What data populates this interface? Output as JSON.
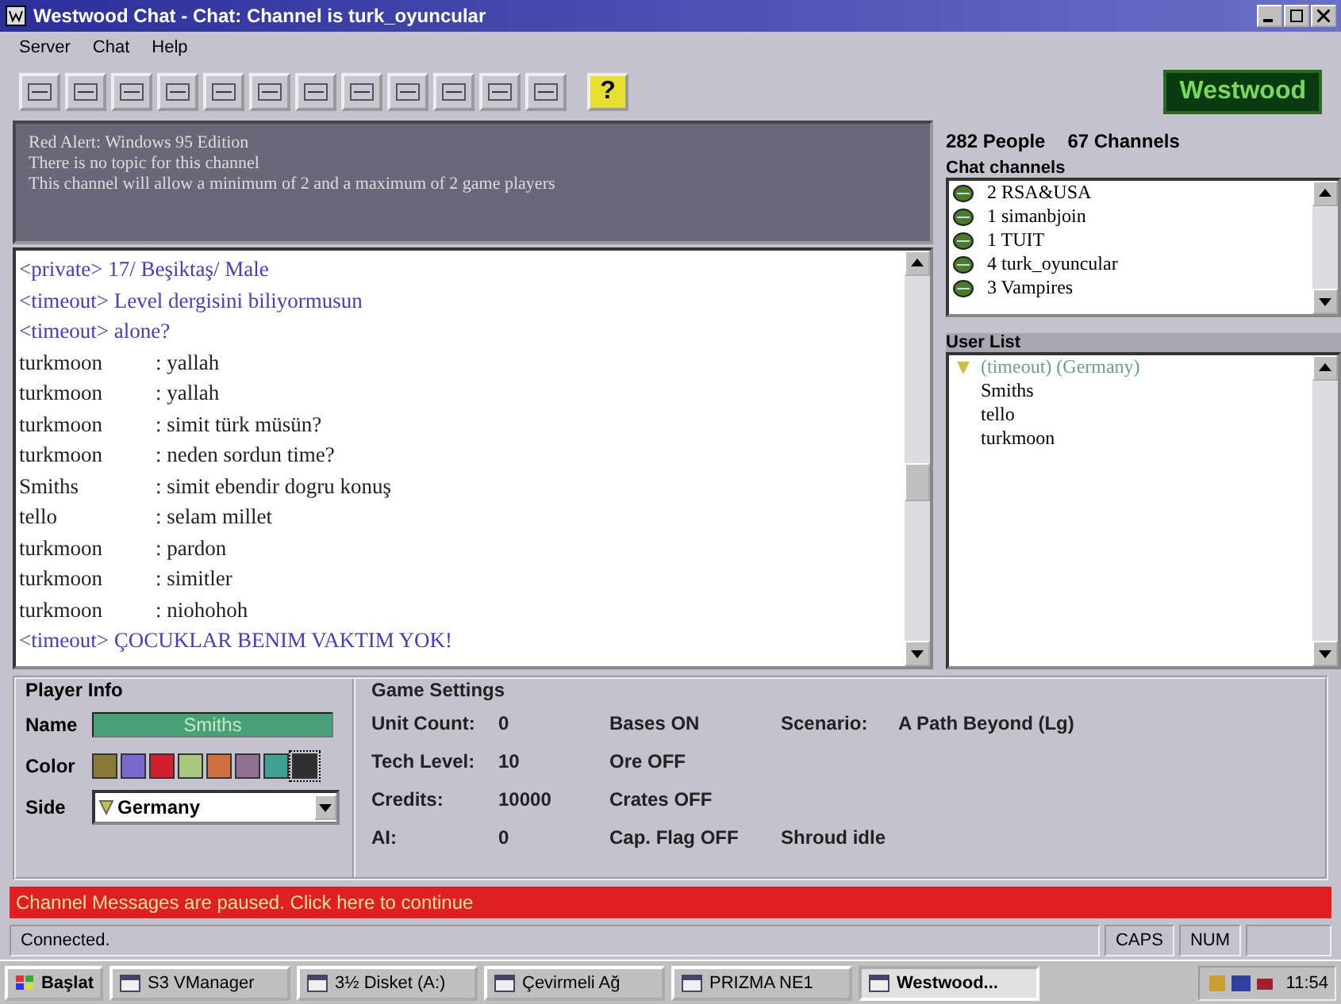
{
  "window": {
    "title": "Westwood Chat - Chat: Channel is turk_oyuncular"
  },
  "menu": [
    "Server",
    "Chat",
    "Help"
  ],
  "toolbar": {
    "help_label": "?",
    "logo": "Westwood"
  },
  "topic": [
    "Red Alert: Windows 95 Edition",
    "There is no topic for this channel",
    "This channel will allow a minimum of 2 and a maximum of 2 game players"
  ],
  "counts": {
    "people": "282",
    "people_label": "People",
    "channels": "67",
    "channels_label": "Channels"
  },
  "chat": [
    {
      "kind": "system",
      "text": "<private> 17/ Beşiktaş/ Male"
    },
    {
      "kind": "system",
      "text": "<timeout> Level dergisini biliyormusun"
    },
    {
      "kind": "system",
      "text": "<timeout> alone?"
    },
    {
      "kind": "user",
      "nick": "turkmoon",
      "text": ": yallah"
    },
    {
      "kind": "user",
      "nick": "turkmoon",
      "text": ": yallah"
    },
    {
      "kind": "user",
      "nick": "turkmoon",
      "text": ": simit türk müsün?"
    },
    {
      "kind": "user",
      "nick": "turkmoon",
      "text": ": neden sordun time?"
    },
    {
      "kind": "user",
      "nick": "Smiths",
      "text": ": simit ebendir dogru konuş"
    },
    {
      "kind": "user",
      "nick": "tello",
      "text": ": selam millet"
    },
    {
      "kind": "user",
      "nick": "turkmoon",
      "text": ": pardon"
    },
    {
      "kind": "user",
      "nick": "turkmoon",
      "text": ": simitler"
    },
    {
      "kind": "user",
      "nick": "turkmoon",
      "text": ": niohohoh"
    },
    {
      "kind": "system",
      "text": "<timeout> ÇOCUKLAR BENIM VAKTIM YOK!"
    }
  ],
  "chat_channels": {
    "title": "Chat channels",
    "items": [
      {
        "count": "2",
        "name": "RSA&USA",
        "selected": false
      },
      {
        "count": "1",
        "name": "simanbjoin",
        "selected": false
      },
      {
        "count": "1",
        "name": "TUIT",
        "selected": false
      },
      {
        "count": "4",
        "name": "turk_oyuncular",
        "selected": false
      },
      {
        "count": "3",
        "name": "Vampires",
        "selected": false
      }
    ]
  },
  "user_list": {
    "title": "User List",
    "items": [
      {
        "kind": "host",
        "name": "(timeout) (Germany)"
      },
      {
        "kind": "user",
        "name": "Smiths"
      },
      {
        "kind": "user",
        "name": "tello"
      },
      {
        "kind": "user",
        "name": "turkmoon"
      }
    ]
  },
  "player_info": {
    "title": "Player Info",
    "name_label": "Name",
    "name": "Smiths",
    "color_label": "Color",
    "colors": [
      {
        "color": "#8a7a3a",
        "selected": false
      },
      {
        "color": "#7a6ad0",
        "selected": false
      },
      {
        "color": "#d02030",
        "selected": false
      },
      {
        "color": "#a8c880",
        "selected": false
      },
      {
        "color": "#d07040",
        "selected": false
      },
      {
        "color": "#907090",
        "selected": false
      },
      {
        "color": "#40a090",
        "selected": false
      },
      {
        "color": "#303030",
        "selected": true
      }
    ],
    "side_label": "Side",
    "side": "Germany"
  },
  "game_settings": {
    "title": "Game Settings",
    "rows": [
      [
        "Unit Count:",
        "0",
        "Bases ON",
        "Scenario:",
        "A Path Beyond (Lg)"
      ],
      [
        "Tech Level:",
        "10",
        "Ore OFF"
      ],
      [
        "Credits:",
        "10000",
        "Crates OFF"
      ],
      [
        "AI:",
        "0",
        "Cap. Flag OFF",
        "Shroud idle"
      ]
    ]
  },
  "notice": "Channel Messages are paused. Click here to continue",
  "status_bar": {
    "text": "Connected.",
    "caps": "CAPS",
    "num": "NUM"
  },
  "taskbar": {
    "start": "Başlat",
    "tasks": [
      {
        "label": "S3 VManager",
        "selected": false
      },
      {
        "label": "3½ Disket (A:)",
        "selected": false
      },
      {
        "label": "Çevirmeli Ağ",
        "selected": false
      },
      {
        "label": "PRIZMA NE1",
        "selected": false
      },
      {
        "label": "Westwood...",
        "selected": true
      }
    ],
    "clock": "11:54"
  }
}
